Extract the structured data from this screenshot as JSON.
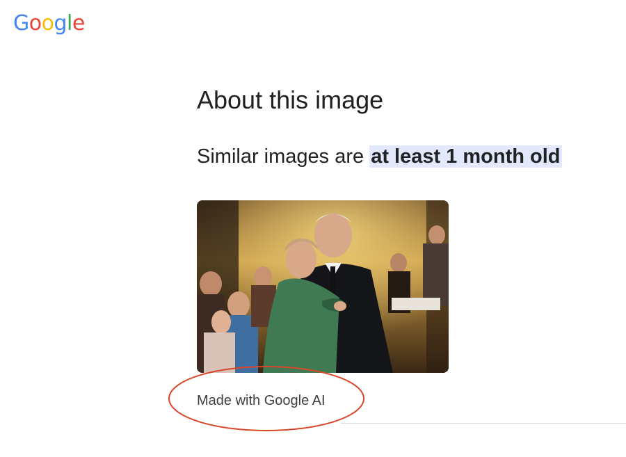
{
  "header": {
    "logo_letters": [
      {
        "char": "G",
        "color": "#4285F4"
      },
      {
        "char": "o",
        "color": "#EA4335"
      },
      {
        "char": "o",
        "color": "#FBBC05"
      },
      {
        "char": "g",
        "color": "#4285F4"
      },
      {
        "char": "l",
        "color": "#34A853"
      },
      {
        "char": "e",
        "color": "#EA4335"
      }
    ]
  },
  "main": {
    "title": "About this image",
    "age_prefix": "Similar images are ",
    "age_highlight": "at least 1 month old",
    "image_icon": "photo-of-couple-dancing",
    "ai_label": "Made with Google AI",
    "annotation_color": "#D9472B",
    "highlight_color": "#E3E9FD"
  }
}
